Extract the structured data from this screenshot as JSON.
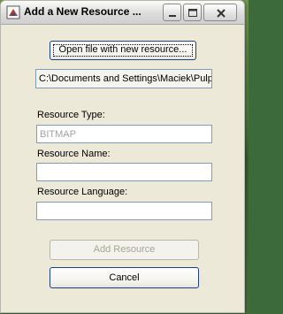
{
  "window": {
    "title": "Add a New Resource ...",
    "title_icon": "app-icon",
    "controls": [
      "minimize-icon",
      "maximize-icon",
      "close-icon"
    ]
  },
  "buttons": {
    "open_file": "Open file with new resource...",
    "add_resource": "Add Resource",
    "cancel": "Cancel"
  },
  "file_path": "C:\\Documents and Settings\\Maciek\\Pulpit",
  "fields": {
    "type_label": "Resource Type:",
    "type_value": "BITMAP",
    "name_label": "Resource Name:",
    "name_value": "",
    "language_label": "Resource Language:",
    "language_value": ""
  },
  "colors": {
    "accent_border": "#1f3f85",
    "field_border": "#7f9db9",
    "dialog_bg": "#ece9d8",
    "disabled_text": "#a7a595"
  }
}
